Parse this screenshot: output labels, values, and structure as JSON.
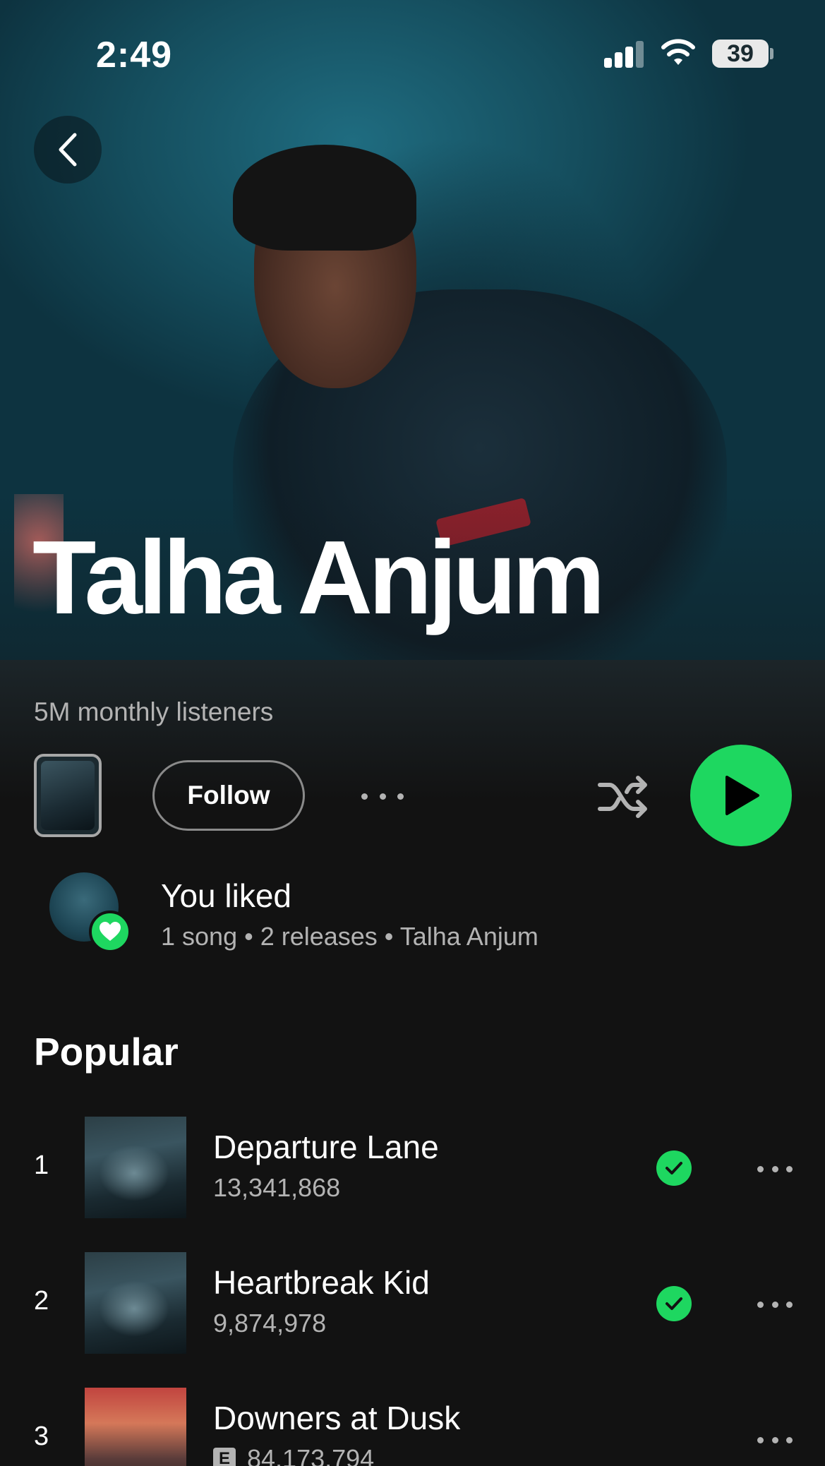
{
  "status_bar": {
    "time": "2:49",
    "battery": "39"
  },
  "artist": {
    "name": "Talha Anjum",
    "monthly_listeners": "5M monthly listeners"
  },
  "actions": {
    "follow_label": "Follow"
  },
  "liked": {
    "title": "You liked",
    "subtitle": "1 song • 2 releases • Talha Anjum"
  },
  "popular": {
    "title": "Popular",
    "tracks": [
      {
        "rank": "1",
        "title": "Departure Lane",
        "plays": "13,341,868",
        "liked": true,
        "explicit": false
      },
      {
        "rank": "2",
        "title": "Heartbreak Kid",
        "plays": "9,874,978",
        "liked": true,
        "explicit": false
      },
      {
        "rank": "3",
        "title": "Downers at Dusk",
        "plays": "84,173,794",
        "liked": false,
        "explicit": true,
        "explicit_label": "E"
      }
    ]
  },
  "colors": {
    "accent": "#1ed760",
    "background": "#121212",
    "secondary_text": "#b3b3b3"
  },
  "icons": [
    "back-chevron-icon",
    "signal-icon",
    "wifi-icon",
    "battery-icon",
    "more-icon",
    "shuffle-icon",
    "play-icon",
    "heart-icon",
    "check-icon"
  ]
}
